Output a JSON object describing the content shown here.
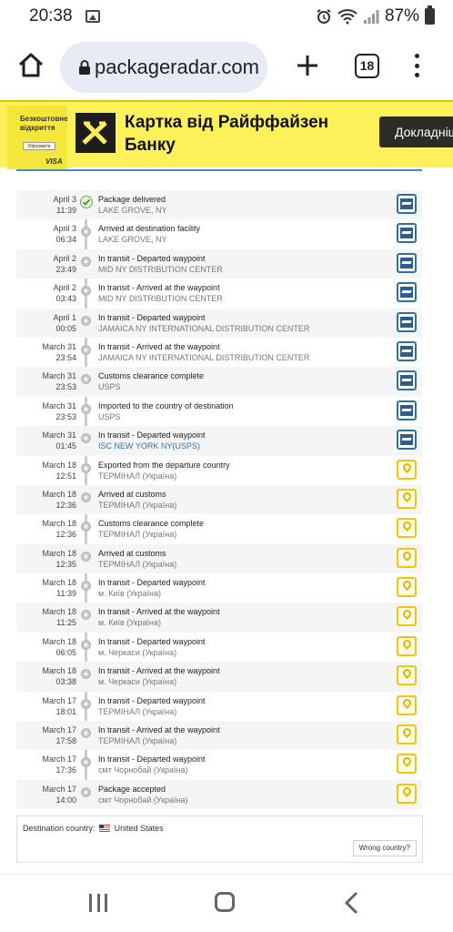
{
  "status_bar": {
    "time": "20:38",
    "battery": "87%"
  },
  "browser": {
    "url": "packageradar.com",
    "tab_count": "18"
  },
  "ad": {
    "badge_text": "Безкоштовне відкриття",
    "badge_button": "Оформити",
    "card_brand": "VISA",
    "title": "Картка від Райффайзен Банку",
    "cta": "Докладніше",
    "brand_color": "#fdf15b"
  },
  "events": [
    {
      "date": "April 3",
      "time": "11:39",
      "status": "Package delivered",
      "location": "LAKE GROVE, NY",
      "carrier": "usps",
      "delivered": true
    },
    {
      "date": "April 3",
      "time": "06:34",
      "status": "Arrived at destination facility",
      "location": "LAKE GROVE, NY",
      "carrier": "usps"
    },
    {
      "date": "April 2",
      "time": "23:49",
      "status": "In transit - Departed waypoint",
      "location": "MID NY DISTRIBUTION CENTER",
      "carrier": "usps"
    },
    {
      "date": "April 2",
      "time": "03:43",
      "status": "In transit - Arrived at the waypoint",
      "location": "MID NY DISTRIBUTION CENTER",
      "carrier": "usps"
    },
    {
      "date": "April 1",
      "time": "00:05",
      "status": "In transit - Departed waypoint",
      "location": "JAMAICA NY INTERNATIONAL DISTRIBUTION CENTER",
      "carrier": "usps"
    },
    {
      "date": "March 31",
      "time": "23:54",
      "status": "In transit - Arrived at the waypoint",
      "location": "JAMAICA NY INTERNATIONAL DISTRIBUTION CENTER",
      "carrier": "usps"
    },
    {
      "date": "March 31",
      "time": "23:53",
      "status": "Customs clearance complete",
      "location": "USPS",
      "carrier": "usps"
    },
    {
      "date": "March 31",
      "time": "23:53",
      "status": "Imported to the country of destination",
      "location": "USPS",
      "carrier": "usps"
    },
    {
      "date": "March 31",
      "time": "01:45",
      "status": "In transit - Departed waypoint",
      "location": "ISC NEW YORK NY(USPS)",
      "carrier": "usps",
      "link": true
    },
    {
      "date": "March 18",
      "time": "12:51",
      "status": "Exported from the departure country",
      "location": "ТЕРМІНАЛ (Україна)",
      "carrier": "ukrposhta"
    },
    {
      "date": "March 18",
      "time": "12:36",
      "status": "Arrived at customs",
      "location": "ТЕРМІНАЛ (Україна)",
      "carrier": "ukrposhta"
    },
    {
      "date": "March 18",
      "time": "12:36",
      "status": "Customs clearance complete",
      "location": "ТЕРМІНАЛ (Україна)",
      "carrier": "ukrposhta"
    },
    {
      "date": "March 18",
      "time": "12:35",
      "status": "Arrived at customs",
      "location": "ТЕРМІНАЛ (Україна)",
      "carrier": "ukrposhta"
    },
    {
      "date": "March 18",
      "time": "11:39",
      "status": "In transit - Departed waypoint",
      "location": "м. Київ (Україна)",
      "carrier": "ukrposhta"
    },
    {
      "date": "March 18",
      "time": "11:25",
      "status": "In transit - Arrived at the waypoint",
      "location": "м. Київ (Україна)",
      "carrier": "ukrposhta"
    },
    {
      "date": "March 18",
      "time": "06:05",
      "status": "In transit - Departed waypoint",
      "location": "м. Черкаси (Україна)",
      "carrier": "ukrposhta"
    },
    {
      "date": "March 18",
      "time": "03:38",
      "status": "In transit - Arrived at the waypoint",
      "location": "м. Черкаси (Україна)",
      "carrier": "ukrposhta"
    },
    {
      "date": "March 17",
      "time": "18:01",
      "status": "In transit - Departed waypoint",
      "location": "ТЕРМІНАЛ (Україна)",
      "carrier": "ukrposhta"
    },
    {
      "date": "March 17",
      "time": "17:58",
      "status": "In transit - Arrived at the waypoint",
      "location": "ТЕРМІНАЛ (Україна)",
      "carrier": "ukrposhta"
    },
    {
      "date": "March 17",
      "time": "17:36",
      "status": "In transit - Departed waypoint",
      "location": "смт Чорнобай (Україна)",
      "carrier": "ukrposhta"
    },
    {
      "date": "March 17",
      "time": "14:00",
      "status": "Package accepted",
      "location": "смт Чорнобай (Україна)",
      "carrier": "ukrposhta"
    }
  ],
  "destination": {
    "label": "Destination country:",
    "country": "United States",
    "wrong_button": "Wrong country?"
  },
  "colors": {
    "accent": "#3d8fc6",
    "link": "#2a72b5",
    "usps": "#2d6f9d",
    "ukrposhta": "#f1c40f"
  }
}
